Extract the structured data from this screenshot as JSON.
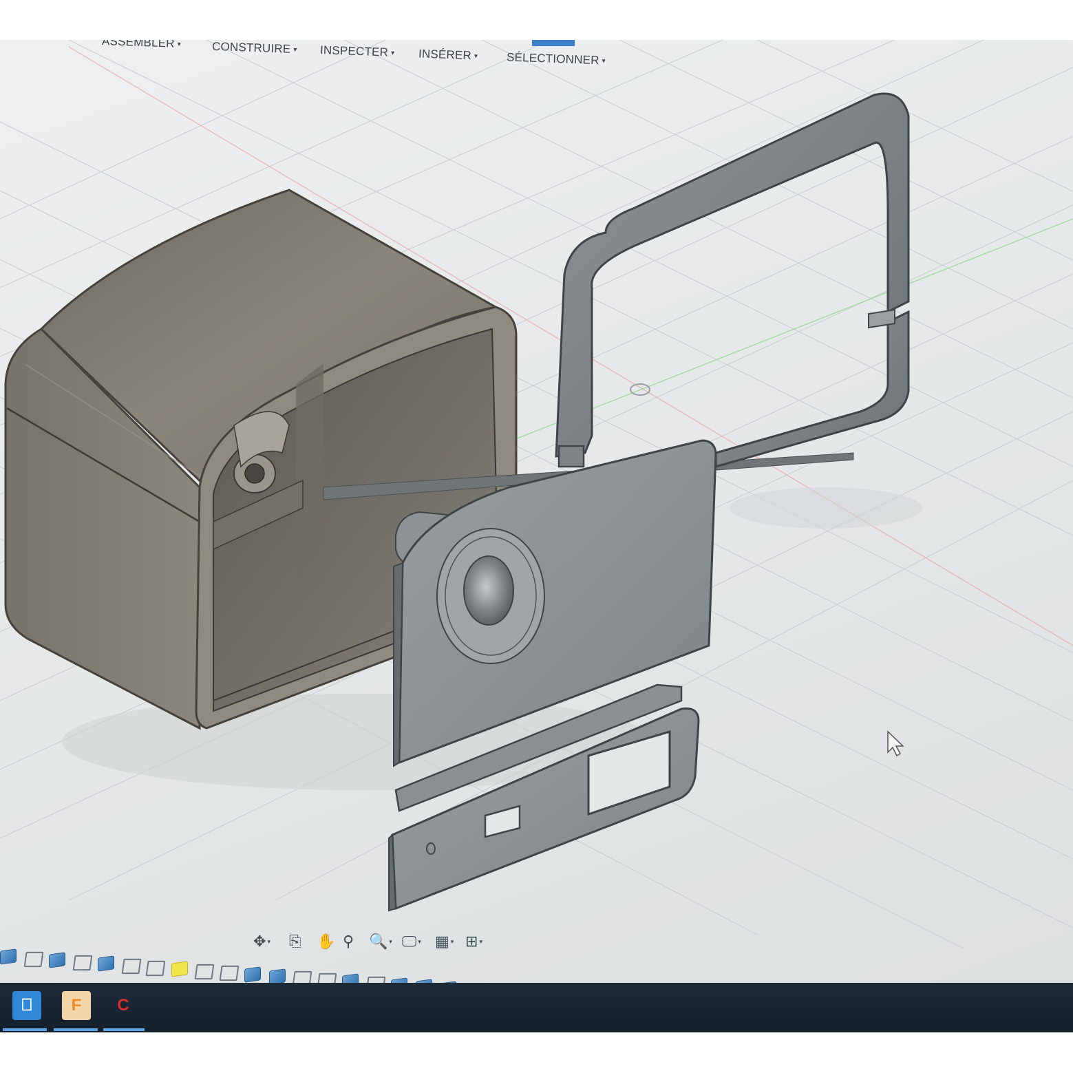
{
  "menubar": {
    "items": [
      {
        "label": "ASSEMBLER"
      },
      {
        "label": "CONSTRUIRE"
      },
      {
        "label": "INSPECTER"
      },
      {
        "label": "INSÉRER"
      },
      {
        "label": "SÉLECTIONNER"
      }
    ],
    "caret_glyph": "▾"
  },
  "navigation_bar": {
    "tools": [
      {
        "icon": "orbit-icon",
        "glyph": "✥",
        "has_dropdown": true
      },
      {
        "icon": "look-at-icon",
        "glyph": "⎘",
        "has_dropdown": false
      },
      {
        "icon": "pan-hand-icon",
        "glyph": "✋",
        "has_dropdown": false
      },
      {
        "icon": "zoom-icon",
        "glyph": "⚲",
        "has_dropdown": false
      },
      {
        "icon": "fit-zoom-icon",
        "glyph": "🔍",
        "has_dropdown": true
      },
      {
        "icon": "display-settings-icon",
        "glyph": "🖵",
        "has_dropdown": true
      },
      {
        "icon": "grid-settings-icon",
        "glyph": "▦",
        "has_dropdown": true
      },
      {
        "icon": "viewports-icon",
        "glyph": "⊞",
        "has_dropdown": true
      }
    ]
  },
  "timeline": {
    "row1": [
      "feature",
      "sketch",
      "feature",
      "sketch",
      "feature",
      "sketch",
      "sketch",
      "selected",
      "sketch",
      "sketch",
      "feature",
      "feature",
      "sketch",
      "sketch",
      "feature",
      "sketch",
      "feature",
      "feature",
      "feature",
      "move",
      "move",
      "sketch",
      "feature",
      "sketch",
      "feature",
      "feature",
      "sketch",
      "feature",
      "sketch",
      "feature",
      "sketch",
      "feature",
      "feature",
      "feature",
      "sketch",
      "feature",
      "move",
      "move",
      "move"
    ],
    "move_glyph": "✥"
  },
  "taskbar": {
    "apps": [
      {
        "icon": "app-launcher-icon",
        "glyph": "⎕",
        "color": "#2f87d8"
      },
      {
        "icon": "fusion-360-icon",
        "glyph": "F",
        "color": "#f08a24"
      },
      {
        "icon": "ccleaner-icon",
        "glyph": "C",
        "color": "#d6302c"
      }
    ]
  },
  "colors": {
    "body_shell": "#807b70",
    "body_shell_dark": "#4c4943",
    "parts_grey": "#8f9597",
    "parts_grey_dark": "#5e6466",
    "grid_line": "#c9ced0"
  }
}
